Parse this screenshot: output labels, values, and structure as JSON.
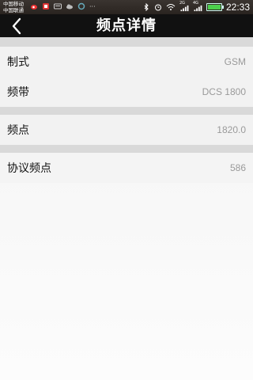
{
  "status_bar": {
    "carrier_1": "中国移动",
    "carrier_2": "中国联通",
    "left_icons": [
      "weibo-icon",
      "app-icon",
      "keyboard-icon",
      "cloud-icon",
      "ring-icon"
    ],
    "ellipsis": "···",
    "right_icons": [
      "bluetooth-icon",
      "alarm-icon",
      "wifi-icon",
      "signal-2g-icon",
      "signal-4g-icon",
      "battery-icon"
    ],
    "badge_2g": "2G",
    "badge_4g": "4G",
    "battery_level": 0.9,
    "time": "22:33"
  },
  "header": {
    "title": "频点详情",
    "back_icon": "chevron-left-icon"
  },
  "sections": [
    {
      "rows": [
        {
          "label": "制式",
          "value": "GSM"
        },
        {
          "label": "频带",
          "value": "DCS 1800"
        }
      ]
    },
    {
      "rows": [
        {
          "label": "频点",
          "value": "1820.0"
        }
      ]
    },
    {
      "rows": [
        {
          "label": "协议频点",
          "value": "586"
        }
      ]
    }
  ]
}
